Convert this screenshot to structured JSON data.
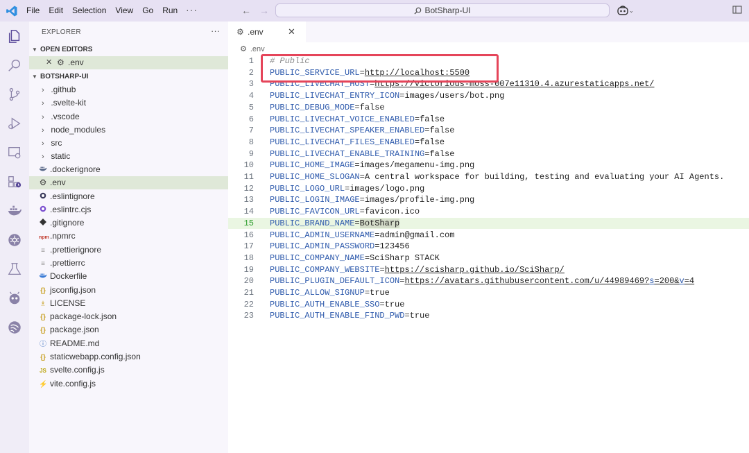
{
  "titlebar": {
    "menu": [
      "File",
      "Edit",
      "Selection",
      "View",
      "Go",
      "Run"
    ],
    "more": "···",
    "search_text": "BotSharp-UI"
  },
  "sidebar": {
    "title": "EXPLORER",
    "more": "···",
    "open_editors_label": "OPEN EDITORS",
    "open_editor_file": ".env",
    "project_label": "BOTSHARP-UI",
    "items": [
      {
        "label": ".github",
        "folder": true
      },
      {
        "label": ".svelte-kit",
        "folder": true
      },
      {
        "label": ".vscode",
        "folder": true
      },
      {
        "label": "node_modules",
        "folder": true
      },
      {
        "label": "src",
        "folder": true
      },
      {
        "label": "static",
        "folder": true
      },
      {
        "label": ".dockerignore",
        "icon": "docker-icon"
      },
      {
        "label": ".env",
        "icon": "gear-icon"
      },
      {
        "label": ".eslintignore",
        "icon": "eslint-icon"
      },
      {
        "label": ".eslintrc.cjs",
        "icon": "eslint-icon"
      },
      {
        "label": ".gitignore",
        "icon": "git-icon"
      },
      {
        "label": ".npmrc",
        "icon": "npm-icon"
      },
      {
        "label": ".prettierignore",
        "icon": "lines-icon"
      },
      {
        "label": ".prettierrc",
        "icon": "lines-icon"
      },
      {
        "label": "Dockerfile",
        "icon": "docker-icon"
      },
      {
        "label": "jsconfig.json",
        "icon": "braces-icon"
      },
      {
        "label": "LICENSE",
        "icon": "license-icon"
      },
      {
        "label": "package-lock.json",
        "icon": "braces-icon"
      },
      {
        "label": "package.json",
        "icon": "braces-icon"
      },
      {
        "label": "README.md",
        "icon": "info-icon"
      },
      {
        "label": "staticwebapp.config.json",
        "icon": "braces-icon"
      },
      {
        "label": "svelte.config.js",
        "icon": "js-icon"
      },
      {
        "label": "vite.config.js",
        "icon": "vite-icon"
      }
    ]
  },
  "tab": {
    "label": ".env",
    "close": "✕"
  },
  "breadcrumb": ".env",
  "editor": {
    "lines": [
      {
        "n": "1",
        "comment": "# Public"
      },
      {
        "n": "2",
        "key": "PUBLIC_SERVICE_URL",
        "val": "http://localhost:5500",
        "url": true
      },
      {
        "n": "3",
        "key": "PUBLIC_LIVECHAT_HOST",
        "val": "https://victorious-moss-007e11310.4.azurestaticapps.net/",
        "url": true
      },
      {
        "n": "4",
        "key": "PUBLIC_LIVECHAT_ENTRY_ICON",
        "val": "images/users/bot.png"
      },
      {
        "n": "5",
        "key": "PUBLIC_DEBUG_MODE",
        "val": "false"
      },
      {
        "n": "6",
        "key": "PUBLIC_LIVECHAT_VOICE_ENABLED",
        "val": "false"
      },
      {
        "n": "7",
        "key": "PUBLIC_LIVECHAT_SPEAKER_ENABLED",
        "val": "false"
      },
      {
        "n": "8",
        "key": "PUBLIC_LIVECHAT_FILES_ENABLED",
        "val": "false"
      },
      {
        "n": "9",
        "key": "PUBLIC_LIVECHAT_ENABLE_TRAINING",
        "val": "false"
      },
      {
        "n": "10",
        "key": "PUBLIC_HOME_IMAGE",
        "val": "images/megamenu-img.png"
      },
      {
        "n": "11",
        "key": "PUBLIC_HOME_SLOGAN",
        "val": "A central workspace for building, testing and evaluating your AI Agents."
      },
      {
        "n": "12",
        "key": "PUBLIC_LOGO_URL",
        "val": "images/logo.png"
      },
      {
        "n": "13",
        "key": "PUBLIC_LOGIN_IMAGE",
        "val": "images/profile-img.png"
      },
      {
        "n": "14",
        "key": "PUBLIC_FAVICON_URL",
        "val": "favicon.ico"
      },
      {
        "n": "15",
        "key": "PUBLIC_BRAND_NAME",
        "val": "BotSharp",
        "active": true,
        "highlight": true
      },
      {
        "n": "16",
        "key": "PUBLIC_ADMIN_USERNAME",
        "val": "admin@gmail.com"
      },
      {
        "n": "17",
        "key": "PUBLIC_ADMIN_PASSWORD",
        "val": "123456"
      },
      {
        "n": "18",
        "key": "PUBLIC_COMPANY_NAME",
        "val": "SciSharp STACK"
      },
      {
        "n": "19",
        "key": "PUBLIC_COMPANY_WEBSITE",
        "val": "https://scisharp.github.io/SciSharp/",
        "url": true
      },
      {
        "n": "20",
        "key": "PUBLIC_PLUGIN_DEFAULT_ICON",
        "val_parts": [
          "https://avatars.githubusercontent.com/u/44989469?",
          "s",
          "=200&",
          "v",
          "=4"
        ]
      },
      {
        "n": "21",
        "key": "PUBLIC_ALLOW_SIGNUP",
        "val": "true"
      },
      {
        "n": "22",
        "key": "PUBLIC_AUTH_ENABLE_SSO",
        "val": "true"
      },
      {
        "n": "23",
        "key": "PUBLIC_AUTH_ENABLE_FIND_PWD",
        "val": "true"
      }
    ]
  },
  "colors": {
    "highlight_box": "#e5455a",
    "key": "#2e5aac",
    "titlebar": "#e7e1f3"
  }
}
